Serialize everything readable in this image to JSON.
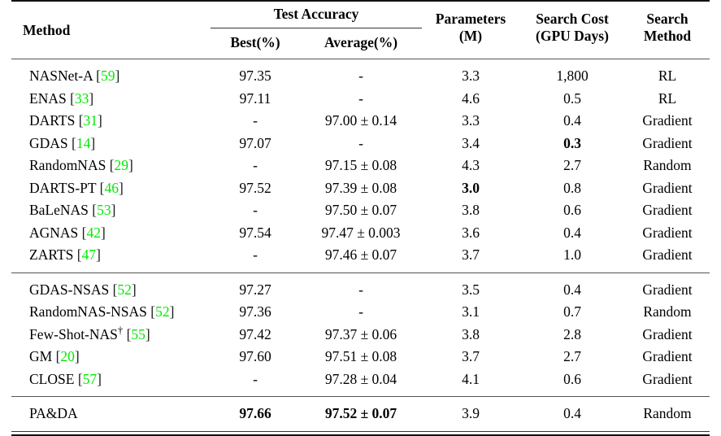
{
  "table": {
    "headers": {
      "method": "Method",
      "group_test_accuracy": "Test Accuracy",
      "best": "Best(%)",
      "average": "Average(%)",
      "parameters_line1": "Parameters",
      "parameters_line2": "(M)",
      "search_cost_line1": "Search Cost",
      "search_cost_line2": "(GPU Days)",
      "search_method_line1": "Search",
      "search_method_line2": "Method"
    },
    "citation_color": "#00ea00",
    "groups": [
      {
        "rows": [
          {
            "method": "NASNet-A",
            "cite": "59",
            "best": "97.35",
            "best_bold": false,
            "average": "-",
            "average_bold": false,
            "parameters": "3.3",
            "parameters_bold": false,
            "search_cost": "1,800",
            "search_cost_bold": false,
            "search_method": "RL"
          },
          {
            "method": "ENAS",
            "cite": "33",
            "best": "97.11",
            "best_bold": false,
            "average": "-",
            "average_bold": false,
            "parameters": "4.6",
            "parameters_bold": false,
            "search_cost": "0.5",
            "search_cost_bold": false,
            "search_method": "RL"
          },
          {
            "method": "DARTS",
            "cite": "31",
            "best": "-",
            "best_bold": false,
            "average": "97.00 ± 0.14",
            "average_bold": false,
            "parameters": "3.3",
            "parameters_bold": false,
            "search_cost": "0.4",
            "search_cost_bold": false,
            "search_method": "Gradient"
          },
          {
            "method": "GDAS",
            "cite": "14",
            "best": "97.07",
            "best_bold": false,
            "average": "-",
            "average_bold": false,
            "parameters": "3.4",
            "parameters_bold": false,
            "search_cost": "0.3",
            "search_cost_bold": true,
            "search_method": "Gradient"
          },
          {
            "method": "RandomNAS",
            "cite": "29",
            "best": "-",
            "best_bold": false,
            "average": "97.15 ± 0.08",
            "average_bold": false,
            "parameters": "4.3",
            "parameters_bold": false,
            "search_cost": "2.7",
            "search_cost_bold": false,
            "search_method": "Random"
          },
          {
            "method": "DARTS-PT",
            "cite": "46",
            "best": "97.52",
            "best_bold": false,
            "average": "97.39 ± 0.08",
            "average_bold": false,
            "parameters": "3.0",
            "parameters_bold": true,
            "search_cost": "0.8",
            "search_cost_bold": false,
            "search_method": "Gradient"
          },
          {
            "method": "BaLeNAS",
            "cite": "53",
            "best": "-",
            "best_bold": false,
            "average": "97.50 ± 0.07",
            "average_bold": false,
            "parameters": "3.8",
            "parameters_bold": false,
            "search_cost": "0.6",
            "search_cost_bold": false,
            "search_method": "Gradient"
          },
          {
            "method": "AGNAS",
            "cite": "42",
            "best": "97.54",
            "best_bold": false,
            "average": "97.47 ± 0.003",
            "average_bold": false,
            "parameters": "3.6",
            "parameters_bold": false,
            "search_cost": "0.4",
            "search_cost_bold": false,
            "search_method": "Gradient"
          },
          {
            "method": "ZARTS",
            "cite": "47",
            "best": "-",
            "best_bold": false,
            "average": "97.46 ± 0.07",
            "average_bold": false,
            "parameters": "3.7",
            "parameters_bold": false,
            "search_cost": "1.0",
            "search_cost_bold": false,
            "search_method": "Gradient"
          }
        ]
      },
      {
        "rows": [
          {
            "method": "GDAS-NSAS",
            "cite": "52",
            "best": "97.27",
            "best_bold": false,
            "average": "-",
            "average_bold": false,
            "parameters": "3.5",
            "parameters_bold": false,
            "search_cost": "0.4",
            "search_cost_bold": false,
            "search_method": "Gradient"
          },
          {
            "method": "RandomNAS-NSAS",
            "cite": "52",
            "best": "97.36",
            "best_bold": false,
            "average": "-",
            "average_bold": false,
            "parameters": "3.1",
            "parameters_bold": false,
            "search_cost": "0.7",
            "search_cost_bold": false,
            "search_method": "Random"
          },
          {
            "method": "Few-Shot-NAS",
            "dagger": true,
            "cite": "55",
            "best": "97.42",
            "best_bold": false,
            "average": "97.37 ± 0.06",
            "average_bold": false,
            "parameters": "3.8",
            "parameters_bold": false,
            "search_cost": "2.8",
            "search_cost_bold": false,
            "search_method": "Gradient"
          },
          {
            "method": "GM",
            "cite": "20",
            "best": "97.60",
            "best_bold": false,
            "average": "97.51 ± 0.08",
            "average_bold": false,
            "parameters": "3.7",
            "parameters_bold": false,
            "search_cost": "2.7",
            "search_cost_bold": false,
            "search_method": "Gradient"
          },
          {
            "method": "CLOSE",
            "cite": "57",
            "best": "-",
            "best_bold": false,
            "average": "97.28 ± 0.04",
            "average_bold": false,
            "parameters": "4.1",
            "parameters_bold": false,
            "search_cost": "0.6",
            "search_cost_bold": false,
            "search_method": "Gradient"
          }
        ]
      },
      {
        "rows": [
          {
            "method": "PA&DA",
            "cite": "",
            "best": "97.66",
            "best_bold": true,
            "average": "97.52 ± 0.07",
            "average_bold": true,
            "parameters": "3.9",
            "parameters_bold": false,
            "search_cost": "0.4",
            "search_cost_bold": false,
            "search_method": "Random"
          }
        ]
      }
    ]
  }
}
